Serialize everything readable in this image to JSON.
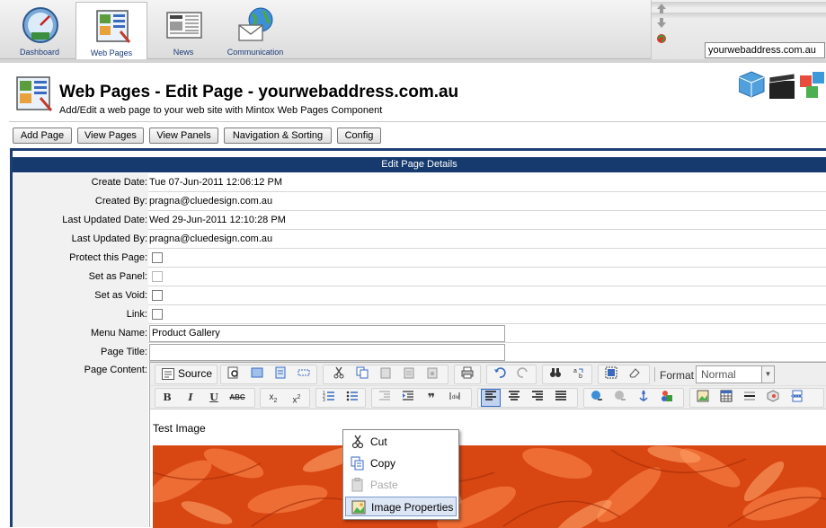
{
  "nav": {
    "tabs": [
      {
        "label": "Dashboard",
        "icon": "dashboard-gauge-icon"
      },
      {
        "label": "Web Pages",
        "icon": "web-pages-icon",
        "active": true
      },
      {
        "label": "News",
        "icon": "newspaper-icon"
      },
      {
        "label": "Communication",
        "icon": "globe-envelope-icon"
      }
    ],
    "domain": "yourwebaddress.com.au"
  },
  "header": {
    "title": "Web Pages - Edit Page - yourwebaddress.com.au",
    "subtitle": "Add/Edit a web page to your web site with Mintox Web Pages Component"
  },
  "toolbar": {
    "buttons": [
      "Add Page",
      "View Pages",
      "View Panels",
      "Navigation & Sorting",
      "Config"
    ]
  },
  "form": {
    "heading": "Edit Page Details",
    "rows": [
      {
        "label": "Create Date:",
        "value": "Tue 07-Jun-2011 12:06:12 PM"
      },
      {
        "label": "Created By:",
        "value": "pragna@cluedesign.com.au"
      },
      {
        "label": "Last Updated Date:",
        "value": "Wed 29-Jun-2011 12:10:28 PM"
      },
      {
        "label": "Last Updated By:",
        "value": "pragna@cluedesign.com.au"
      },
      {
        "label": "Protect this Page:"
      },
      {
        "label": "Set as Panel:"
      },
      {
        "label": "Set as Void:"
      },
      {
        "label": "Link:"
      },
      {
        "label": "Menu Name:",
        "value": "Product Gallery"
      },
      {
        "label": "Page Title:",
        "value": ""
      },
      {
        "label": "Page Content:"
      }
    ]
  },
  "editor": {
    "source_label": "Source",
    "format_label": "Format",
    "format_value": "Normal",
    "content_text": "Test Image"
  },
  "context_menu": {
    "items": [
      {
        "label": "Cut",
        "icon": "scissors-icon",
        "enabled": true
      },
      {
        "label": "Copy",
        "icon": "copy-icon",
        "enabled": true
      },
      {
        "label": "Paste",
        "icon": "paste-icon",
        "enabled": false
      },
      {
        "label": "Image Properties",
        "icon": "image-icon",
        "enabled": true,
        "highlighted": true
      }
    ]
  },
  "colors": {
    "header_bar": "#163a6e",
    "label_bg": "#f1f1f1",
    "flower": "#e8531b"
  }
}
